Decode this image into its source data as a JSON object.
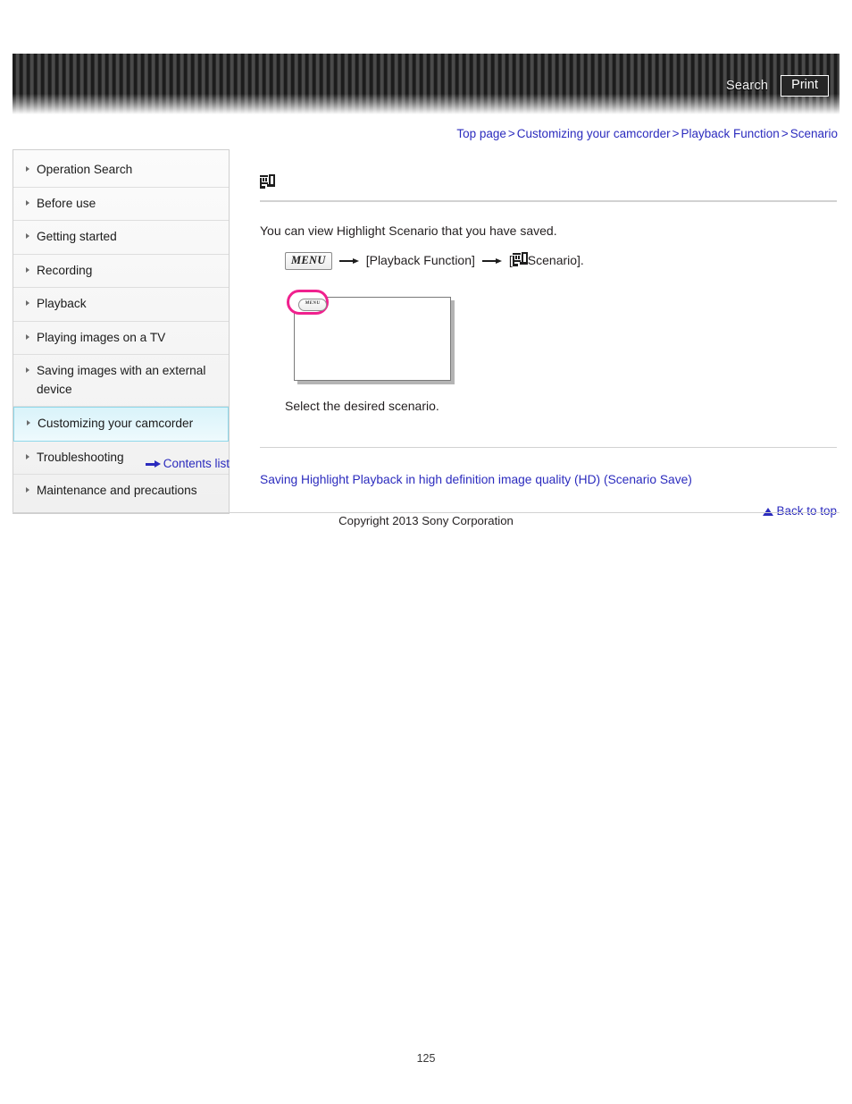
{
  "header": {
    "search_label": "Search",
    "print_label": "Print"
  },
  "breadcrumb": {
    "items": [
      {
        "label": "Top page"
      },
      {
        "label": "Customizing your camcorder"
      },
      {
        "label": "Playback Function"
      },
      {
        "label": "Scenario"
      }
    ],
    "separator": ">"
  },
  "sidebar": {
    "items": [
      {
        "label": "Operation Search",
        "selected": false
      },
      {
        "label": "Before use",
        "selected": false
      },
      {
        "label": "Getting started",
        "selected": false
      },
      {
        "label": "Recording",
        "selected": false
      },
      {
        "label": "Playback",
        "selected": false
      },
      {
        "label": "Playing images on a TV",
        "selected": false
      },
      {
        "label": "Saving images with an external device",
        "selected": false
      },
      {
        "label": "Customizing your camcorder",
        "selected": true
      },
      {
        "label": "Troubleshooting",
        "selected": false
      },
      {
        "label": "Maintenance and precautions",
        "selected": false
      }
    ],
    "contents_list_label": "Contents list"
  },
  "main": {
    "title_icon": "scenario-glyph-icon",
    "body_text": "You can view Highlight Scenario that you have saved.",
    "step": {
      "menu_chip_label": "MENU",
      "arrow": "→",
      "part1": "[Playback Function]",
      "part2_open": "[",
      "part2_label": "Scenario].",
      "icon": "scenario-glyph-icon"
    },
    "illustration": {
      "menu_button_label": "MENU",
      "highlight_color": "#f0218e"
    },
    "caption": "Select the desired scenario.",
    "related_link": "Saving Highlight Playback in high definition image quality (HD) (Scenario Save)",
    "back_to_top_label": "Back to top"
  },
  "footer": {
    "copyright": "Copyright 2013 Sony Corporation",
    "page_number": "125"
  },
  "colors": {
    "link": "#2b2bbe",
    "selected_nav_border": "#8fd8ea",
    "highlight_pink": "#f0218e",
    "banner_dark": "#1c1c1c"
  }
}
